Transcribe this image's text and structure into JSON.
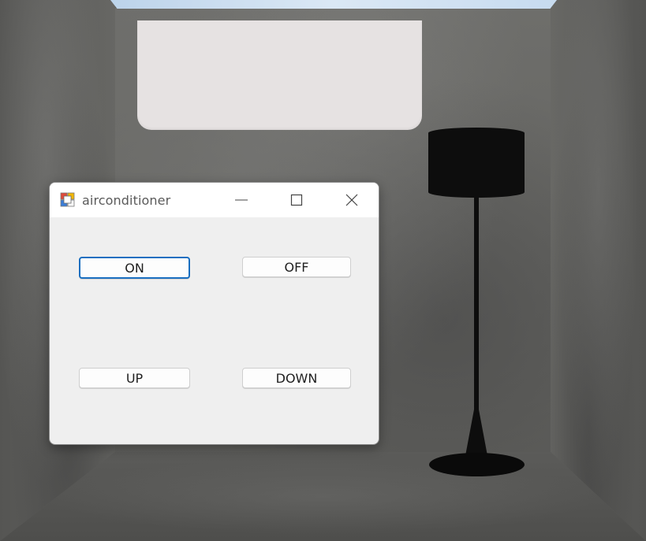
{
  "window": {
    "title": "airconditioner",
    "controls": {
      "minimize": "minimize-icon",
      "maximize": "maximize-icon",
      "close": "close-icon"
    }
  },
  "buttons": {
    "on": "ON",
    "off": "OFF",
    "up": "UP",
    "down": "DOWN"
  },
  "colors": {
    "focus_border": "#1a6fc0",
    "window_bg": "#efefef",
    "titlebar_bg": "#ffffff"
  }
}
